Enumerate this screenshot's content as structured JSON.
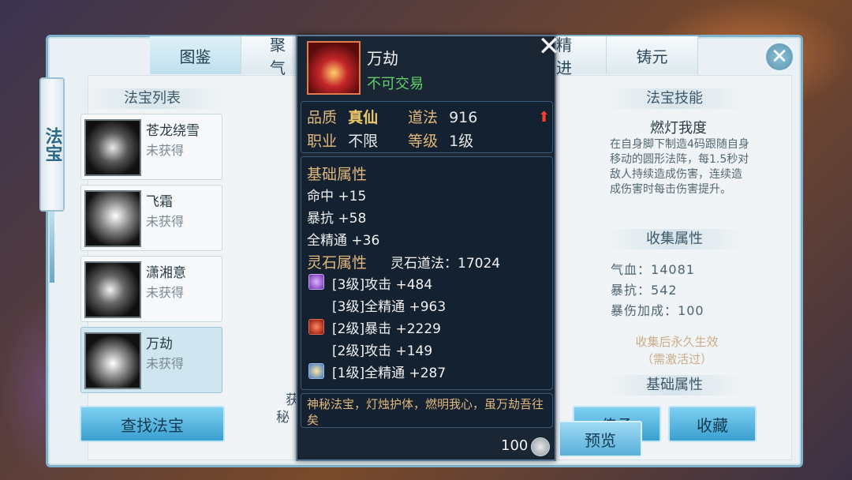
{
  "tabs": [
    "图鉴",
    "聚气",
    "精进",
    "铸元"
  ],
  "banner": "法宝",
  "left": {
    "title": "法宝列表",
    "items": [
      {
        "name": "苍龙绕雪",
        "status": "未获得"
      },
      {
        "name": "飞霜",
        "status": "未获得"
      },
      {
        "name": "潇湘意",
        "status": "未获得"
      },
      {
        "name": "万劫",
        "status": "未获得"
      }
    ],
    "find_button": "查找法宝"
  },
  "right": {
    "skill_title": "法宝技能",
    "skill_name": "燃灯我度",
    "skill_desc": "在自身脚下制造4码跟随自身移动的圆形法阵，每1.5秒对敌人持续造成伤害，连续造成伤害时每击伤害提升。",
    "collect_title": "收集属性",
    "collect_stats": [
      {
        "label": "气血",
        "value": "14081"
      },
      {
        "label": "暴抗",
        "value": "542"
      },
      {
        "label": "暴伤加成",
        "value": "100"
      }
    ],
    "collect_note": "收集后永久生效",
    "collect_note2": "（需激活过）",
    "base_title": "基础属性",
    "btn_inherit": "传承",
    "btn_collect": "收藏",
    "btn_preview": "预览"
  },
  "hidden_left_text": [
    "获",
    "秘"
  ],
  "tooltip": {
    "name": "万劫",
    "trade": "不可交易",
    "quality_label": "品质",
    "quality_value": "真仙",
    "daofa_label": "道法",
    "daofa_value": "916",
    "job_label": "职业",
    "job_value": "不限",
    "level_label": "等级",
    "level_value": "1级",
    "base_heading": "基础属性",
    "base_stats": [
      "命中 +15",
      "暴抗 +58",
      "全精通 +36"
    ],
    "gem_heading": "灵石属性",
    "gem_daofa": "灵石道法：17024",
    "gem_stats": [
      "[3级]攻击 +484",
      "[3级]全精通 +963",
      "[2级]暴击 +2229",
      "[2级]攻击 +149",
      "[1级]全精通 +287"
    ],
    "desc": "神秘法宝，灯烛护体，燃明我心，虽万劫吾往矣",
    "price": "100"
  }
}
